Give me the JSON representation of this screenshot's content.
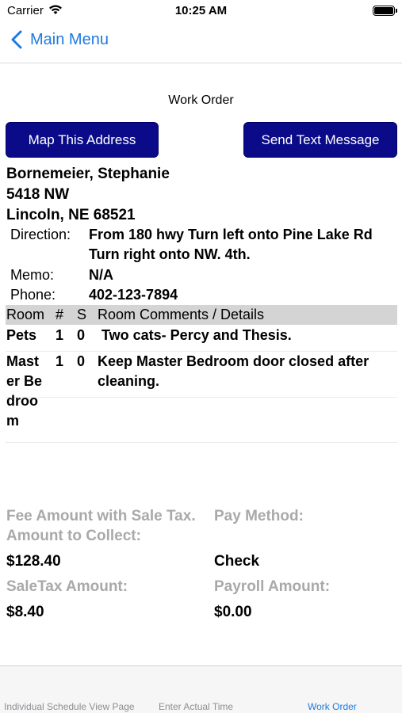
{
  "status_bar": {
    "carrier": "Carrier",
    "time": "10:25 AM"
  },
  "nav": {
    "back_label": "Main Menu"
  },
  "page_title": "Work Order",
  "buttons": {
    "map": "Map This Address",
    "text": "Send Text Message"
  },
  "client": {
    "name": "Bornemeier, Stephanie",
    "address_line1": "5418 NW",
    "address_line2": "Lincoln, NE 68521"
  },
  "details": {
    "direction_label": "Direction:",
    "direction_value": "From 180 hwy Turn left onto Pine Lake Rd Turn right onto NW. 4th.",
    "memo_label": "Memo:",
    "memo_value": "N/A",
    "phone_label": "Phone:",
    "phone_value": "402-123-7894"
  },
  "room_table": {
    "headers": {
      "room": "Room",
      "num": "#",
      "s": "S",
      "comments": "Room Comments / Details"
    },
    "rows": [
      {
        "room": "Pets",
        "num": "1",
        "s": "0",
        "comments": "Two cats- Percy and Thesis."
      },
      {
        "room": "Master Bedroom",
        "num": "1",
        "s": "0",
        "comments": "Keep Master Bedroom door closed after cleaning."
      }
    ]
  },
  "fees": {
    "fee_label": "Fee Amount with Sale Tax. Amount to Collect:",
    "fee_value": "$128.40",
    "pay_method_label": "Pay Method:",
    "pay_method_value": "Check",
    "sale_tax_label": "SaleTax Amount:",
    "sale_tax_value": "$8.40",
    "payroll_label": "Payroll Amount:",
    "payroll_value": "$0.00"
  },
  "tabs": [
    {
      "label": "Individual Schedule View Page",
      "active": false
    },
    {
      "label": "Enter Actual Time",
      "active": false
    },
    {
      "label": "Work Order",
      "active": true
    }
  ],
  "colors": {
    "accent": "#1f7ae0",
    "button_bg": "#0b0b8a",
    "table_header_bg": "#d4d4d4",
    "muted_label": "#a9a9a9"
  },
  "icons": {
    "wifi": "wifi-icon",
    "battery": "battery-icon",
    "back": "chevron-left-icon"
  }
}
